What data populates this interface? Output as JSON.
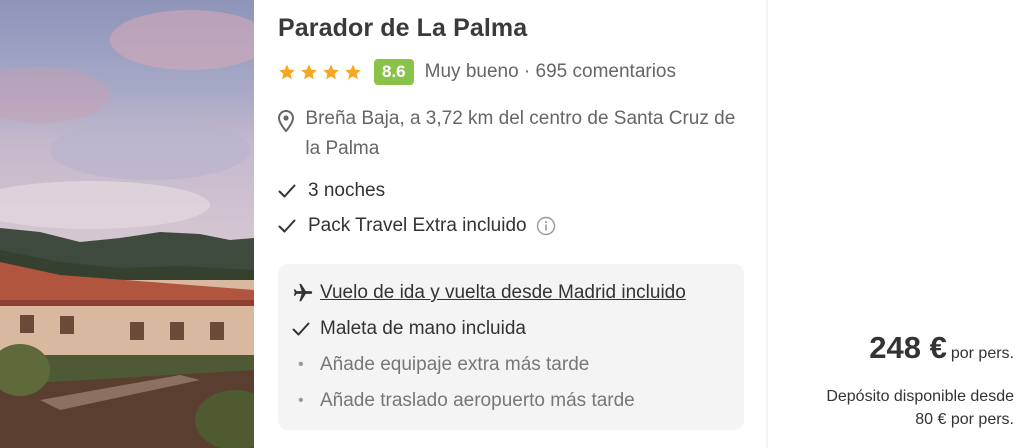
{
  "hotel": {
    "name": "Parador de La Palma",
    "stars": 4,
    "score": "8.6",
    "rating_text": "Muy bueno · 695 comentarios",
    "location": "Breña Baja, a 3,72 km del centro de Santa Cruz de la Palma",
    "features": [
      "3 noches",
      "Pack Travel Extra incluido"
    ]
  },
  "included": {
    "flight": "Vuelo de ida y vuelta desde Madrid incluido",
    "bag": "Maleta de mano incluida",
    "extra_luggage": "Añade equipaje extra más tarde",
    "transfer": "Añade traslado aeropuerto más tarde"
  },
  "price": {
    "amount": "248 €",
    "unit": "por pers.",
    "deposit_line1": "Depósito disponible desde",
    "deposit_line2": "80 € por pers."
  },
  "colors": {
    "score_badge": "#8bc34a",
    "star": "#f5a623",
    "include_box": "#f4f4f4"
  },
  "icons": {
    "location": "location-pin-icon",
    "check": "check-icon",
    "info": "info-icon",
    "flight": "airplane-icon"
  }
}
